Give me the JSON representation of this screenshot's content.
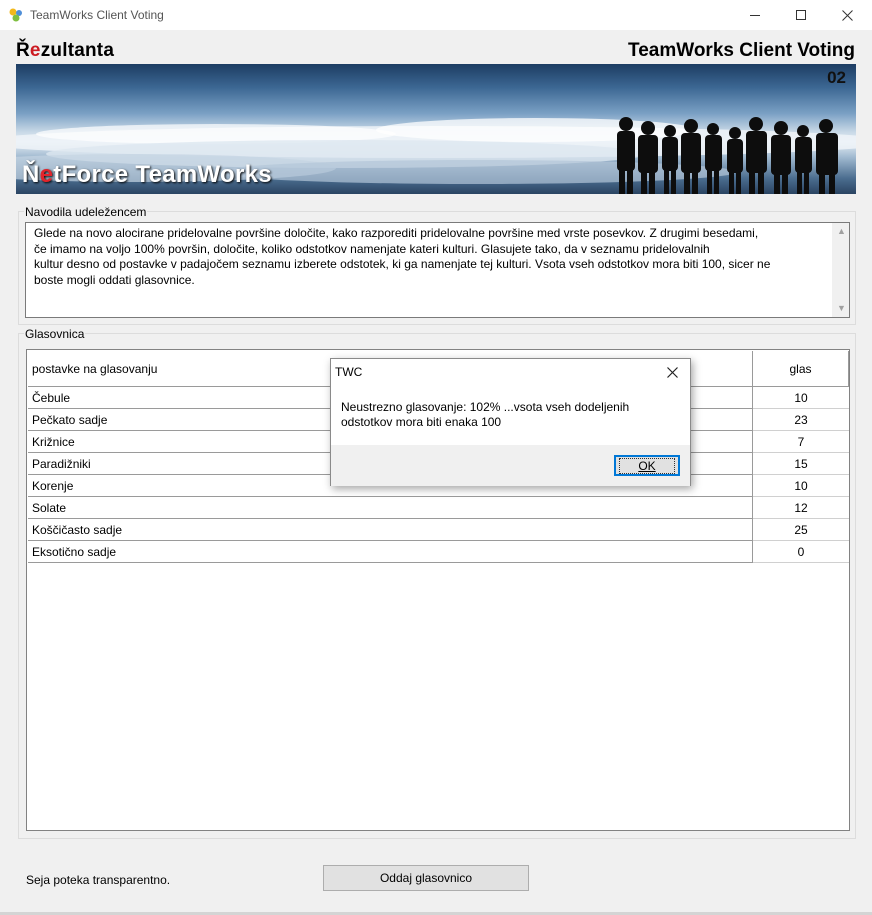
{
  "window": {
    "title": "TeamWorks Client Voting",
    "minimize_icon": "minimize-icon",
    "maximize_icon": "maximize-icon",
    "close_icon": "close-icon"
  },
  "header": {
    "page_title": "Řezultanta",
    "brand_title": "TeamWorks Client Voting",
    "session_code": "02",
    "logo_text": "ŇetForce TeamWorks"
  },
  "instructions": {
    "group_label": "Navodila udeležencem",
    "text": "Glede na novo alocirane pridelovalne površine določite, kako razporediti pridelovalne površine med vrste posevkov. Z drugimi besedami,\nče imamo na voljo 100% površin, določite, koliko odstotkov namenjate kateri kulturi. Glasujete tako, da v seznamu pridelovalnih\nkultur desno od postavke v padajočem seznamu izberete odstotek, ki ga namenjate tej kulturi. Vsota vseh odstotkov mora biti 100, sicer ne\nboste mogli oddati glasovnice."
  },
  "ballot": {
    "group_label": "Glasovnica",
    "col_item": "postavke na glasovanju",
    "col_vote": "glas",
    "rows": [
      {
        "item": "Čebule",
        "vote": "10"
      },
      {
        "item": "Pečkato sadje",
        "vote": "23"
      },
      {
        "item": "Križnice",
        "vote": "7"
      },
      {
        "item": "Paradižniki",
        "vote": "15"
      },
      {
        "item": "Korenje",
        "vote": "10"
      },
      {
        "item": "Solate",
        "vote": "12"
      },
      {
        "item": "Koščičasto sadje",
        "vote": "25"
      },
      {
        "item": "Eksotično sadje",
        "vote": "0"
      }
    ]
  },
  "footer": {
    "status": "Seja poteka transparentno.",
    "submit_label": "Oddaj glasovnico"
  },
  "dialog": {
    "title": "TWC",
    "message": "Neustrezno glasovanje: 102% ...vsota vseh dodeljenih odstotkov mora biti enaka 100",
    "ok_label": "OK"
  },
  "colors": {
    "accent_red": "#cc1b22",
    "focus_blue": "#0078d7"
  }
}
